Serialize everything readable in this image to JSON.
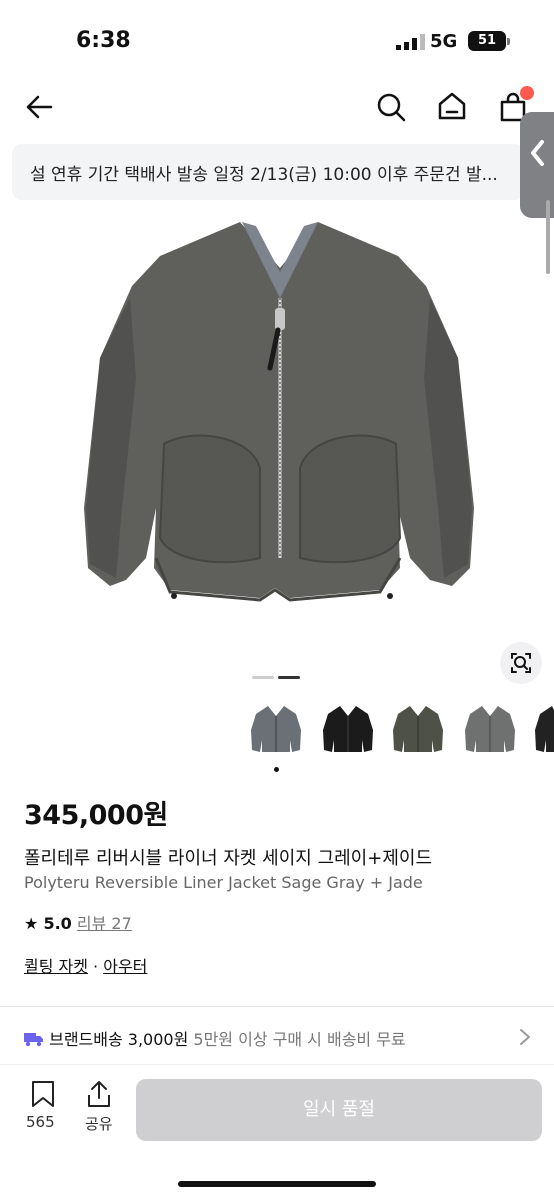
{
  "status_bar": {
    "time": "6:38",
    "network": "5G",
    "battery": "51"
  },
  "notice": {
    "text": "설 연휴 기간 택배사 발송 일정 2/13(금) 10:00 이후 주문건 발..."
  },
  "gallery": {
    "image_count": 2,
    "current_image": 2
  },
  "thumbnails": [
    {
      "label": "gray-jacket-thumbnail",
      "color": "#6b6f76"
    },
    {
      "label": "black-jacket-thumbnail",
      "color": "#1b1b1b"
    },
    {
      "label": "olive-jacket-thumbnail",
      "color": "#4e5148"
    },
    {
      "label": "sage-gray-jacket-thumbnail",
      "color": "#6f7170"
    },
    {
      "label": "dark-jacket-thumbnail",
      "color": "#222"
    }
  ],
  "product": {
    "price": "345,000원",
    "name_ko": "폴리테루 리버시블 라이너 자켓 세이지 그레이+제이드",
    "name_en": "Polyteru Reversible Liner Jacket Sage Gray + Jade",
    "rating": "5.0",
    "review_label": "리뷰 27",
    "category": "퀼팅 자켓",
    "category_sep": " · ",
    "category_parent": "아우터"
  },
  "shipping": {
    "label": "브랜드배송 3,000원",
    "note": "5만원 이상 구매 시 배송비 무료"
  },
  "bottom": {
    "bookmark_count": "565",
    "share_label": "공유",
    "cta_label": "일시 품절"
  },
  "colors": {
    "accent_red": "#ff5a4e",
    "disabled_button": "#cfcfd1",
    "truck_purple": "#6b63f0"
  }
}
